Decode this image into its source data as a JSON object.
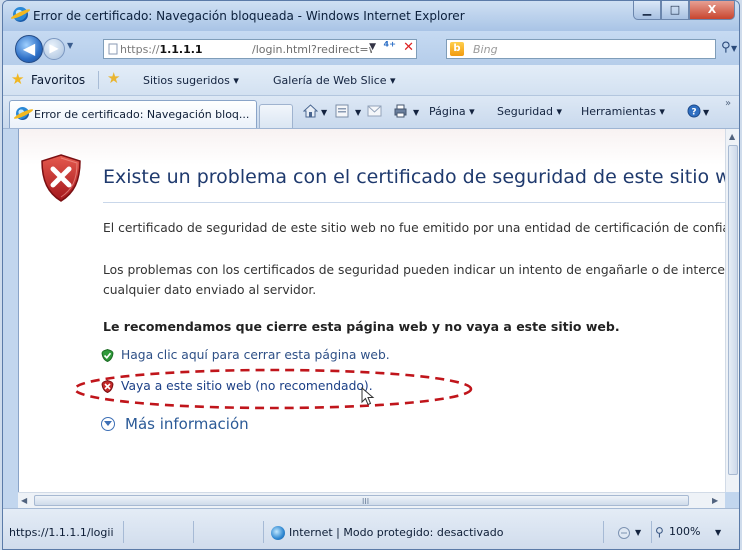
{
  "window": {
    "title": "Error de certificado: Navegación bloqueada - Windows Internet Explorer",
    "minimize_glyph": "▁",
    "maximize_glyph": "□",
    "close_glyph": "X"
  },
  "address_bar": {
    "url_prefix": "https://",
    "url_host": "1.1.1.1",
    "url_path": "/login.html?redirect=www.upao.",
    "refresh_glyph": "⁴⁺",
    "stop_glyph": "✕"
  },
  "search": {
    "placeholder": "Bing",
    "engine_icon": "bing-icon"
  },
  "favorites_bar": {
    "favorites_label": "Favoritos",
    "items": [
      {
        "label": "Sitios sugeridos ▾"
      },
      {
        "label": "Galería de Web Slice ▾"
      }
    ]
  },
  "tab": {
    "title": "Error de certificado: Navegación bloq..."
  },
  "command_bar": {
    "items": [
      {
        "label": "Página ▾"
      },
      {
        "label": "Seguridad ▾"
      },
      {
        "label": "Herramientas ▾"
      }
    ],
    "overflow": "»"
  },
  "page": {
    "heading": "Existe un problema con el certificado de seguridad de este sitio web.",
    "paragraph1": "El certificado de seguridad de este sitio web no fue emitido por una entidad de certificación de confianz",
    "paragraph2_line1": "Los problemas con los certificados de seguridad pueden indicar un intento de engañarle o de intercept",
    "paragraph2_line2": "cualquier dato enviado al servidor.",
    "recommendation": "Le recomendamos que cierre esta página web y no vaya a este sitio web.",
    "close_link": "Haga clic aquí para cerrar esta página web.",
    "continue_link": "Vaya a este sitio web (no recomendado).",
    "more_info": "Más información",
    "highlight_color": "#c0151b"
  },
  "status_bar": {
    "url": "https://1.1.1.1/logii",
    "zone": "Internet | Modo protegido: desactivado",
    "zoom": "100%"
  },
  "colors": {
    "link_blue": "#1b3f86",
    "heading_blue": "#1f3a6e",
    "shield_red": "#c42a2a",
    "ok_green": "#2f9a3a"
  }
}
